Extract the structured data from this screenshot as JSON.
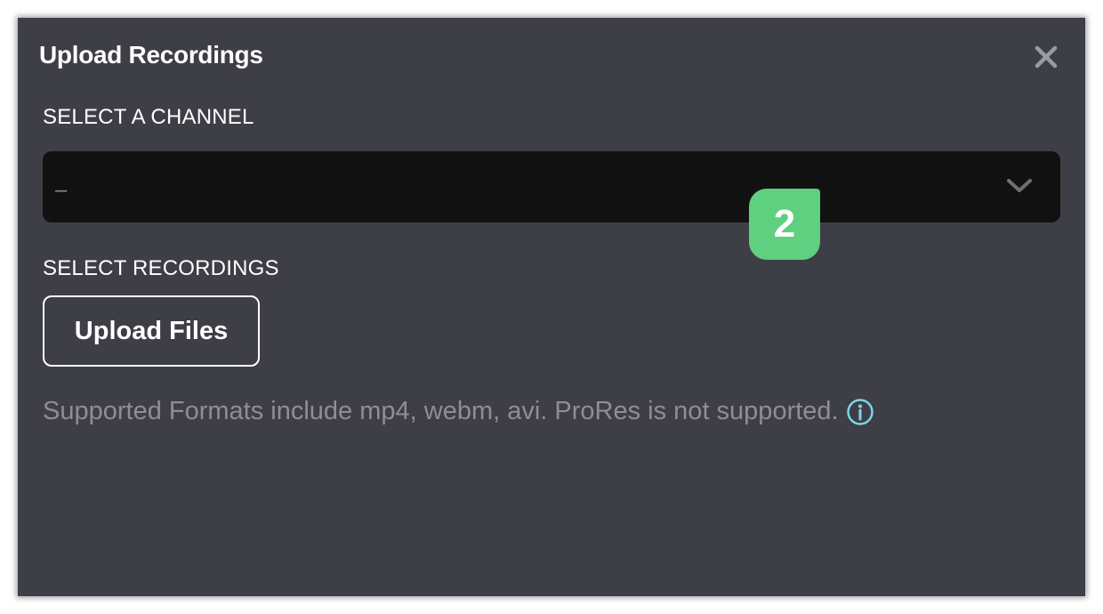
{
  "dialog": {
    "title": "Upload Recordings"
  },
  "channel": {
    "label": "SELECT A CHANNEL",
    "selected_value": "–"
  },
  "recordings": {
    "label": "SELECT RECORDINGS",
    "upload_button": "Upload Files"
  },
  "formats_note": "Supported Formats include mp4, webm, avi. ProRes is not supported.",
  "step_badge": "2",
  "colors": {
    "modal_bg": "#3d3e46",
    "select_bg": "#111112",
    "badge": "#5fcf80",
    "info_icon": "#7fd4e8"
  },
  "icons": {
    "close": "close-icon",
    "dropdown": "chevron-down-icon",
    "info": "info-icon"
  }
}
